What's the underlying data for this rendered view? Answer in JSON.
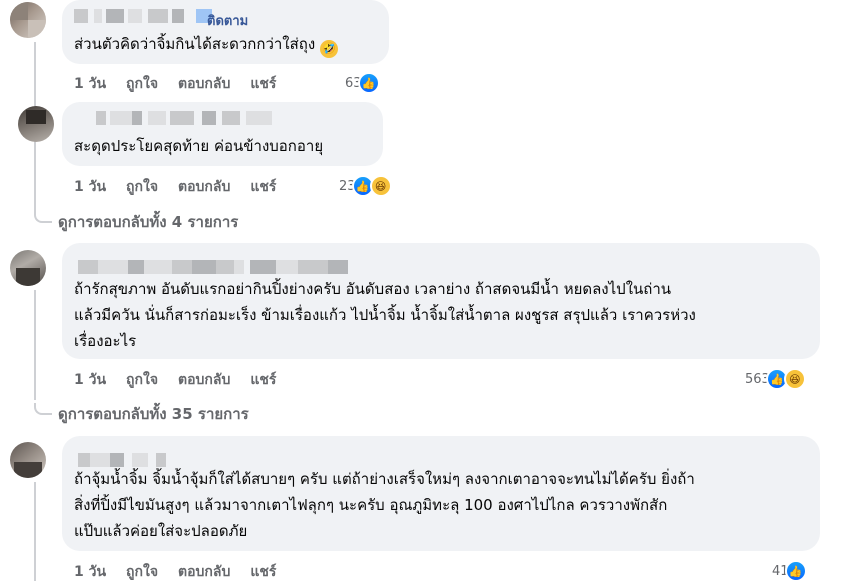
{
  "comments": [
    {
      "author_tag": "ติดตาม",
      "text": "ส่วนตัวคิดว่าจิ้มกินได้สะดวกกว่าใส่ถุง",
      "emoji": "🤣",
      "actions": {
        "time": "1 วัน",
        "like": "ถูกใจ",
        "reply": "ตอบกลับ",
        "share": "แชร์"
      },
      "reaction_count": "63",
      "reaction_icons": [
        "like-icon"
      ]
    },
    {
      "text": "สะดุดประโยคสุดท้าย ค่อนข้างบอกอายุ",
      "actions": {
        "time": "1 วัน",
        "like": "ถูกใจ",
        "reply": "ตอบกลับ",
        "share": "แชร์"
      },
      "reaction_count": "23",
      "reaction_icons": [
        "like-icon",
        "haha-icon"
      ]
    },
    {
      "text": "ถ้ารักสุขภาพ อันดับแรกอย่ากินปิ้งย่างครับ อันดับสอง เวลาย่าง ถ้าสดจนมีน้ำ หยดลงไปในถ่าน\nแล้วมีควัน นั่นก็สารก่อมะเร็ง ข้ามเรื่องแก้ว ไปน้ำจิ้ม น้ำจิ้มใส่น้ำตาล ผงชูรส สรุปแล้ว เราควรห่วง\nเรื่องอะไร",
      "actions": {
        "time": "1 วัน",
        "like": "ถูกใจ",
        "reply": "ตอบกลับ",
        "share": "แชร์"
      },
      "reaction_count": "563",
      "reaction_icons": [
        "like-icon",
        "haha-icon"
      ]
    },
    {
      "text": "ถ้าจุ้มน้ำจิ้ม จิ้มน้ำจุ้มก็ใส่ได้สบายๆ ครับ แต่ถ้าย่างเสร็จใหม่ๆ ลงจากเตาอาจจะทนไม่ได้ครับ ยิ่งถ้า\nสิ่งที่ปิ้งมีไขมันสูงๆ แล้วมาจากเตาไฟลุกๆ นะครับ อุณภูมิทะลุ 100 องศาไปไกล ควรวางพักสัก\nแป๊บแล้วค่อยใส่จะปลอดภัย",
      "actions": {
        "time": "1 วัน",
        "like": "ถูกใจ",
        "reply": "ตอบกลับ",
        "share": "แชร์"
      },
      "reaction_count": "41",
      "reaction_icons": [
        "like-icon"
      ]
    }
  ],
  "view_replies": [
    {
      "label": "ดูการตอบกลับทั้ง 4 รายการ"
    },
    {
      "label": "ดูการตอบกลับทั้ง 35 รายการ"
    }
  ],
  "colors": {
    "bubble": "#f0f2f5",
    "meta": "#65676b",
    "accent": "#0866ff"
  }
}
